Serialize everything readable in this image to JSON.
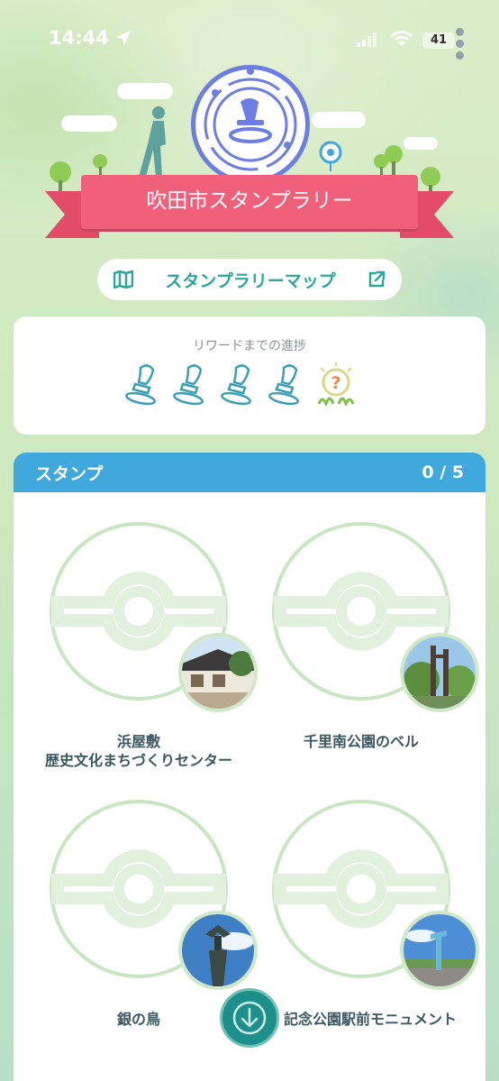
{
  "status_bar": {
    "time": "14:44",
    "battery": "41",
    "icons": [
      "location-arrow-icon",
      "signal-icon",
      "wifi-icon",
      "battery-icon",
      "more-dots-icon"
    ]
  },
  "header": {
    "title": "吹田市スタンプラリー",
    "map_button_label": "スタンプラリーマップ"
  },
  "progress": {
    "title": "リワードまでの進捗",
    "stamps_collected": 0,
    "stamp_slots": 4,
    "reward_icon": "mystery-reward-icon"
  },
  "stamps": {
    "title": "スタンプ",
    "count": "0 / 5",
    "items": [
      {
        "label_line1": "浜屋敷",
        "label_line2": "歴史文化まちづくりセンター",
        "photo": "traditional-house-photo"
      },
      {
        "label_line1": "千里南公園のベル",
        "label_line2": "",
        "photo": "bell-tower-photo"
      },
      {
        "label_line1": "銀の鳥",
        "label_line2": "",
        "photo": "silver-bird-statue-photo"
      },
      {
        "label_line1": "記念公園駅前モニュメント",
        "label_line2": "",
        "photo": "station-monument-photo"
      }
    ]
  },
  "colors": {
    "ribbon": "#f0607a",
    "accent_teal": "#2aa79c",
    "stamps_header": "#3fa8dc",
    "medal_border": "#6c7de3"
  }
}
